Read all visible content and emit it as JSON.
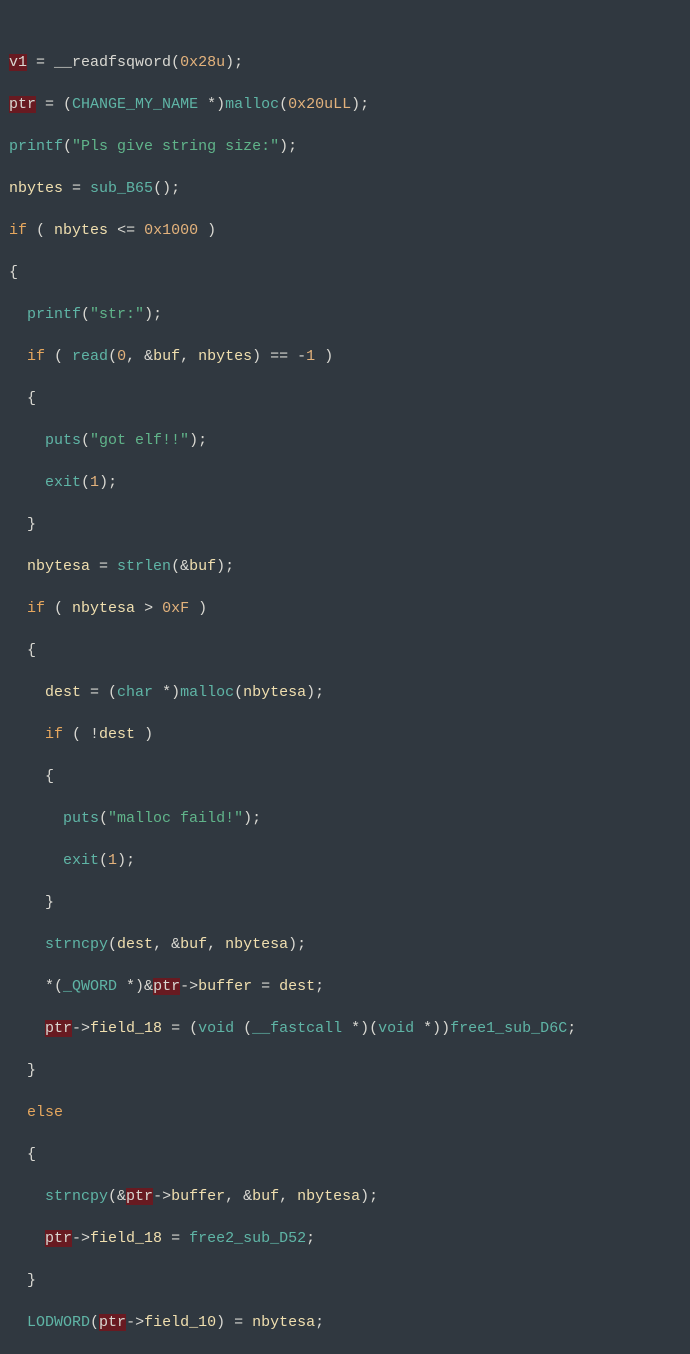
{
  "code": {
    "l1_a": "v1",
    "l1_b": " = __readfsqword(",
    "l1_c": "0x28u",
    "l1_d": ");",
    "l2_a": "ptr",
    "l2_b": " = (",
    "l2_c": "CHANGE_MY_NAME",
    "l2_d": " *)",
    "l2_e": "malloc",
    "l2_f": "(",
    "l2_g": "0x20uLL",
    "l2_h": ");",
    "l3_a": "printf",
    "l3_b": "(",
    "l3_c": "\"Pls give string size:\"",
    "l3_d": ");",
    "l4_a": "nbytes",
    "l4_b": " = ",
    "l4_c": "sub_B65",
    "l4_d": "();",
    "l5_a": "if",
    "l5_b": " ( ",
    "l5_c": "nbytes",
    "l5_d": " <= ",
    "l5_e": "0x1000",
    "l5_f": " )",
    "l6": "{",
    "l7_a": "printf",
    "l7_b": "(",
    "l7_c": "\"str:\"",
    "l7_d": ");",
    "l8_a": "if",
    "l8_b": " ( ",
    "l8_c": "read",
    "l8_d": "(",
    "l8_e": "0",
    "l8_f": ", &",
    "l8_g": "buf",
    "l8_h": ", ",
    "l8_i": "nbytes",
    "l8_j": ") == -",
    "l8_k": "1",
    "l8_l": " )",
    "l9": "{",
    "l10_a": "puts",
    "l10_b": "(",
    "l10_c": "\"got elf!!\"",
    "l10_d": ");",
    "l11_a": "exit",
    "l11_b": "(",
    "l11_c": "1",
    "l11_d": ");",
    "l12": "}",
    "l13_a": "nbytesa",
    "l13_b": " = ",
    "l13_c": "strlen",
    "l13_d": "(&",
    "l13_e": "buf",
    "l13_f": ");",
    "l14_a": "if",
    "l14_b": " ( ",
    "l14_c": "nbytesa",
    "l14_d": " > ",
    "l14_e": "0xF",
    "l14_f": " )",
    "l15": "{",
    "l16_a": "dest",
    "l16_b": " = (",
    "l16_c": "char",
    "l16_d": " *)",
    "l16_e": "malloc",
    "l16_f": "(",
    "l16_g": "nbytesa",
    "l16_h": ");",
    "l17_a": "if",
    "l17_b": " ( !",
    "l17_c": "dest",
    "l17_d": " )",
    "l18": "{",
    "l19_a": "puts",
    "l19_b": "(",
    "l19_c": "\"malloc faild!\"",
    "l19_d": ");",
    "l20_a": "exit",
    "l20_b": "(",
    "l20_c": "1",
    "l20_d": ");",
    "l21": "}",
    "l22_a": "strncpy",
    "l22_b": "(",
    "l22_c": "dest",
    "l22_d": ", &",
    "l22_e": "buf",
    "l22_f": ", ",
    "l22_g": "nbytesa",
    "l22_h": ");",
    "l23_a": "*(",
    "l23_b": "_QWORD",
    "l23_c": " *)&",
    "l23_d": "ptr",
    "l23_e": "->",
    "l23_f": "buffer",
    "l23_g": " = ",
    "l23_h": "dest",
    "l23_i": ";",
    "l24_a": "ptr",
    "l24_b": "->",
    "l24_c": "field_18",
    "l24_d": " = (",
    "l24_e": "void",
    "l24_f": " (",
    "l24_g": "__fastcall",
    "l24_h": " *)(",
    "l24_i": "void",
    "l24_j": " *))",
    "l24_k": "free1_sub_D6C",
    "l24_l": ";",
    "l25": "}",
    "l26": "else",
    "l27": "{",
    "l28_a": "strncpy",
    "l28_b": "(&",
    "l28_c": "ptr",
    "l28_d": "->",
    "l28_e": "buffer",
    "l28_f": ", &",
    "l28_g": "buf",
    "l28_h": ", ",
    "l28_i": "nbytesa",
    "l28_j": ");",
    "l29_a": "ptr",
    "l29_b": "->",
    "l29_c": "field_18",
    "l29_d": " = ",
    "l29_e": "free2_sub_D52",
    "l29_f": ";",
    "l30": "}",
    "l31_a": "LODWORD",
    "l31_b": "(",
    "l31_c": "ptr",
    "l31_d": "->",
    "l31_e": "field_10",
    "l31_f": ") = ",
    "l31_g": "nbytesa",
    "l31_h": ";"
  }
}
